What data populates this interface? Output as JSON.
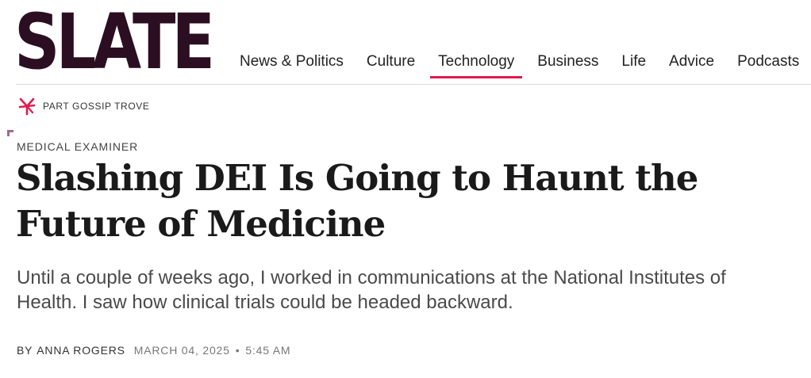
{
  "site": {
    "logo_text": "SLATE",
    "logo_color": "#2c0e22"
  },
  "nav": {
    "items": [
      {
        "label": "News & Politics"
      },
      {
        "label": "Culture"
      },
      {
        "label": "Technology",
        "active": true
      },
      {
        "label": "Business"
      },
      {
        "label": "Life"
      },
      {
        "label": "Advice"
      },
      {
        "label": "Podcasts"
      }
    ],
    "active_color": "#e01a4f"
  },
  "partner": {
    "icon": "part-gossip-trove-logo-icon",
    "label": "PART GOSSIP TROVE"
  },
  "article": {
    "kicker": "MEDICAL EXAMINER",
    "headline": "Slashing DEI Is Going to Haunt the Future of Medicine",
    "dek": "Until a couple of weeks ago, I worked in communications at the National Institutes of Health. I saw how clinical trials could be headed backward.",
    "byline": {
      "prefix": "BY",
      "author": "ANNA ROGERS",
      "date": "MARCH 04, 2025",
      "separator": "•",
      "time": "5:45 AM"
    }
  }
}
